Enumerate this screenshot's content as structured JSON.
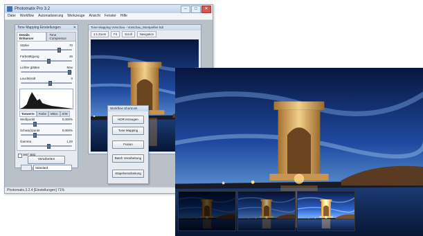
{
  "app": {
    "title": "Photomatix Pro 3.2",
    "menus": [
      "Datei",
      "Workflow",
      "Automatisierung",
      "Werkzeuge",
      "Ansicht",
      "Fenster",
      "Hilfe"
    ],
    "window_controls": [
      "–",
      "□",
      "✕"
    ],
    "status_text": "Photomatix.3.2.4 [Einstellungen] 71%"
  },
  "tone_panel": {
    "title": "Tone Mapping Einstellungen",
    "tabs": [
      "Details Enhancer",
      "Tone Compressor"
    ],
    "sliders": [
      {
        "label": "Stärke",
        "value": "70"
      },
      {
        "label": "Farbsättigung",
        "value": "46"
      },
      {
        "label": "Lichter glätten",
        "value": "Max"
      },
      {
        "label": "Leuchtkraft",
        "value": "0"
      }
    ],
    "subtabs": [
      "Tonwerte",
      "Farbe",
      "Mikro",
      "S/W"
    ],
    "tone_sliders": [
      {
        "label": "Weißpunkt",
        "value": "0,000%"
      },
      {
        "label": "Schwarzpunkt",
        "value": "0,000%"
      },
      {
        "label": "Gamma",
        "value": "1,00"
      }
    ],
    "checkbox_label": "360° Bild",
    "preset_label": "Voreinstellungen",
    "preset_value": "Standard",
    "process_button": "Verarbeiten"
  },
  "image_window": {
    "title": "Tone Mapping Vorschau - Vorschau_Montpellier.hdr",
    "toolbar": [
      "1:1 Zoom",
      "Fit",
      "Scroll",
      "Navigation"
    ]
  },
  "workflow_window": {
    "title": "Workflow Shortcuts",
    "buttons": [
      "HDR erzeugen",
      "Tone Mapping",
      "Fusion",
      "Batch Verarbeitung",
      "Stapelverarbeitung"
    ]
  },
  "colors": {
    "sky_top": "#08163d",
    "sky_mid": "#1f4aa0",
    "sky_low": "#7db1e2",
    "tower_light": "#f2d08a",
    "tower_shadow": "#8a5c28",
    "water": "#0a1c40"
  }
}
